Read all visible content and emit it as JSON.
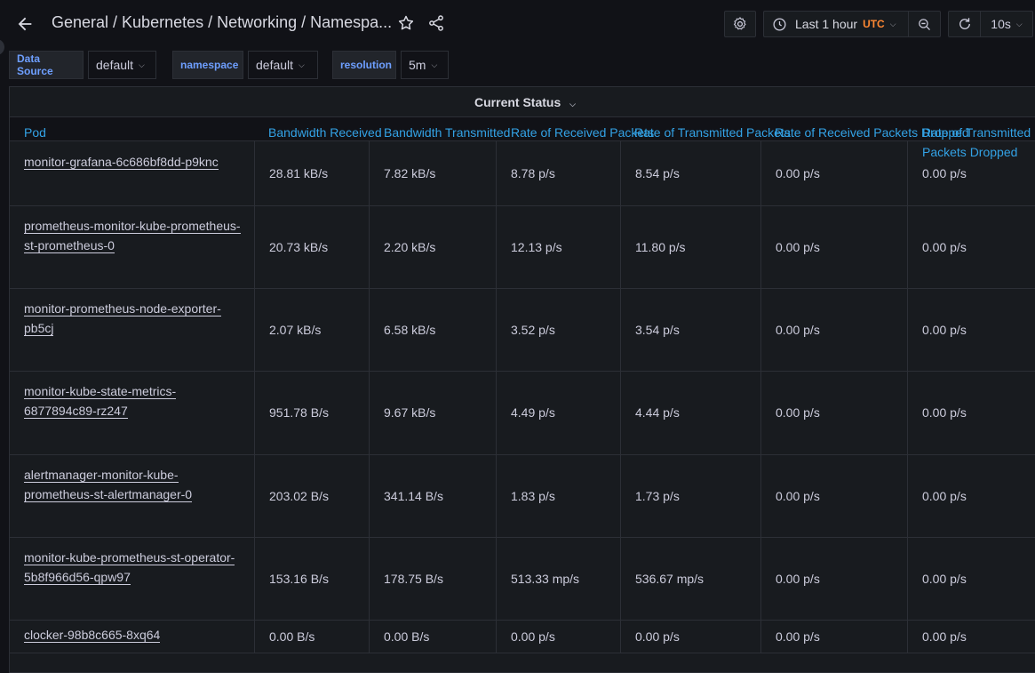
{
  "header": {
    "breadcrumb": "General  / Kubernetes / Networking / Namespa...",
    "time_range": "Last 1 hour",
    "timezone": "UTC",
    "refresh_interval": "10s"
  },
  "variables": [
    {
      "label": "Data Source",
      "value": "default"
    },
    {
      "label": "namespace",
      "value": "default"
    },
    {
      "label": "resolution",
      "value": "5m"
    }
  ],
  "panel": {
    "title": "Current Status",
    "columns": [
      "Pod",
      "Bandwidth Received",
      "Bandwidth Transmitted",
      "Rate of Received Packets",
      "Rate of Transmitted Packets",
      "Rate of Received Packets Dropped",
      "Rate of Transmitted Packets Dropped"
    ],
    "rows": [
      {
        "pod": "monitor-grafana-6c686bf8dd-p9knc",
        "bw_rx": "28.81 kB/s",
        "bw_tx": "7.82 kB/s",
        "pkt_rx": "8.78 p/s",
        "pkt_tx": "8.54 p/s",
        "drop_rx": "0.00 p/s",
        "drop_tx": "0.00 p/s"
      },
      {
        "pod": "prometheus-monitor-kube-prometheus-st-prometheus-0",
        "bw_rx": "20.73 kB/s",
        "bw_tx": "2.20 kB/s",
        "pkt_rx": "12.13 p/s",
        "pkt_tx": "11.80 p/s",
        "drop_rx": "0.00 p/s",
        "drop_tx": "0.00 p/s"
      },
      {
        "pod": "monitor-prometheus-node-exporter-pb5cj",
        "bw_rx": "2.07 kB/s",
        "bw_tx": "6.58 kB/s",
        "pkt_rx": "3.52 p/s",
        "pkt_tx": "3.54 p/s",
        "drop_rx": "0.00 p/s",
        "drop_tx": "0.00 p/s"
      },
      {
        "pod": "monitor-kube-state-metrics-6877894c89-rz247",
        "bw_rx": "951.78 B/s",
        "bw_tx": "9.67 kB/s",
        "pkt_rx": "4.49 p/s",
        "pkt_tx": "4.44 p/s",
        "drop_rx": "0.00 p/s",
        "drop_tx": "0.00 p/s"
      },
      {
        "pod": "alertmanager-monitor-kube-prometheus-st-alertmanager-0",
        "bw_rx": "203.02 B/s",
        "bw_tx": "341.14 B/s",
        "pkt_rx": "1.83 p/s",
        "pkt_tx": "1.73 p/s",
        "drop_rx": "0.00 p/s",
        "drop_tx": "0.00 p/s"
      },
      {
        "pod": "monitor-kube-prometheus-st-operator-5b8f966d56-qpw97",
        "bw_rx": "153.16 B/s",
        "bw_tx": "178.75 B/s",
        "pkt_rx": "513.33 mp/s",
        "pkt_tx": "536.67 mp/s",
        "drop_rx": "0.00 p/s",
        "drop_tx": "0.00 p/s"
      },
      {
        "pod": "clocker-98b8c665-8xq64",
        "bw_rx": "0.00 B/s",
        "bw_tx": "0.00 B/s",
        "pkt_rx": "0.00 p/s",
        "pkt_tx": "0.00 p/s",
        "drop_rx": "0.00 p/s",
        "drop_tx": "0.00 p/s"
      }
    ]
  },
  "colors": {
    "background": "#111217",
    "panel": "#181b1f",
    "link": "#33a2e5",
    "variable_label": "#6e9fff",
    "timezone": "#ff8833"
  }
}
